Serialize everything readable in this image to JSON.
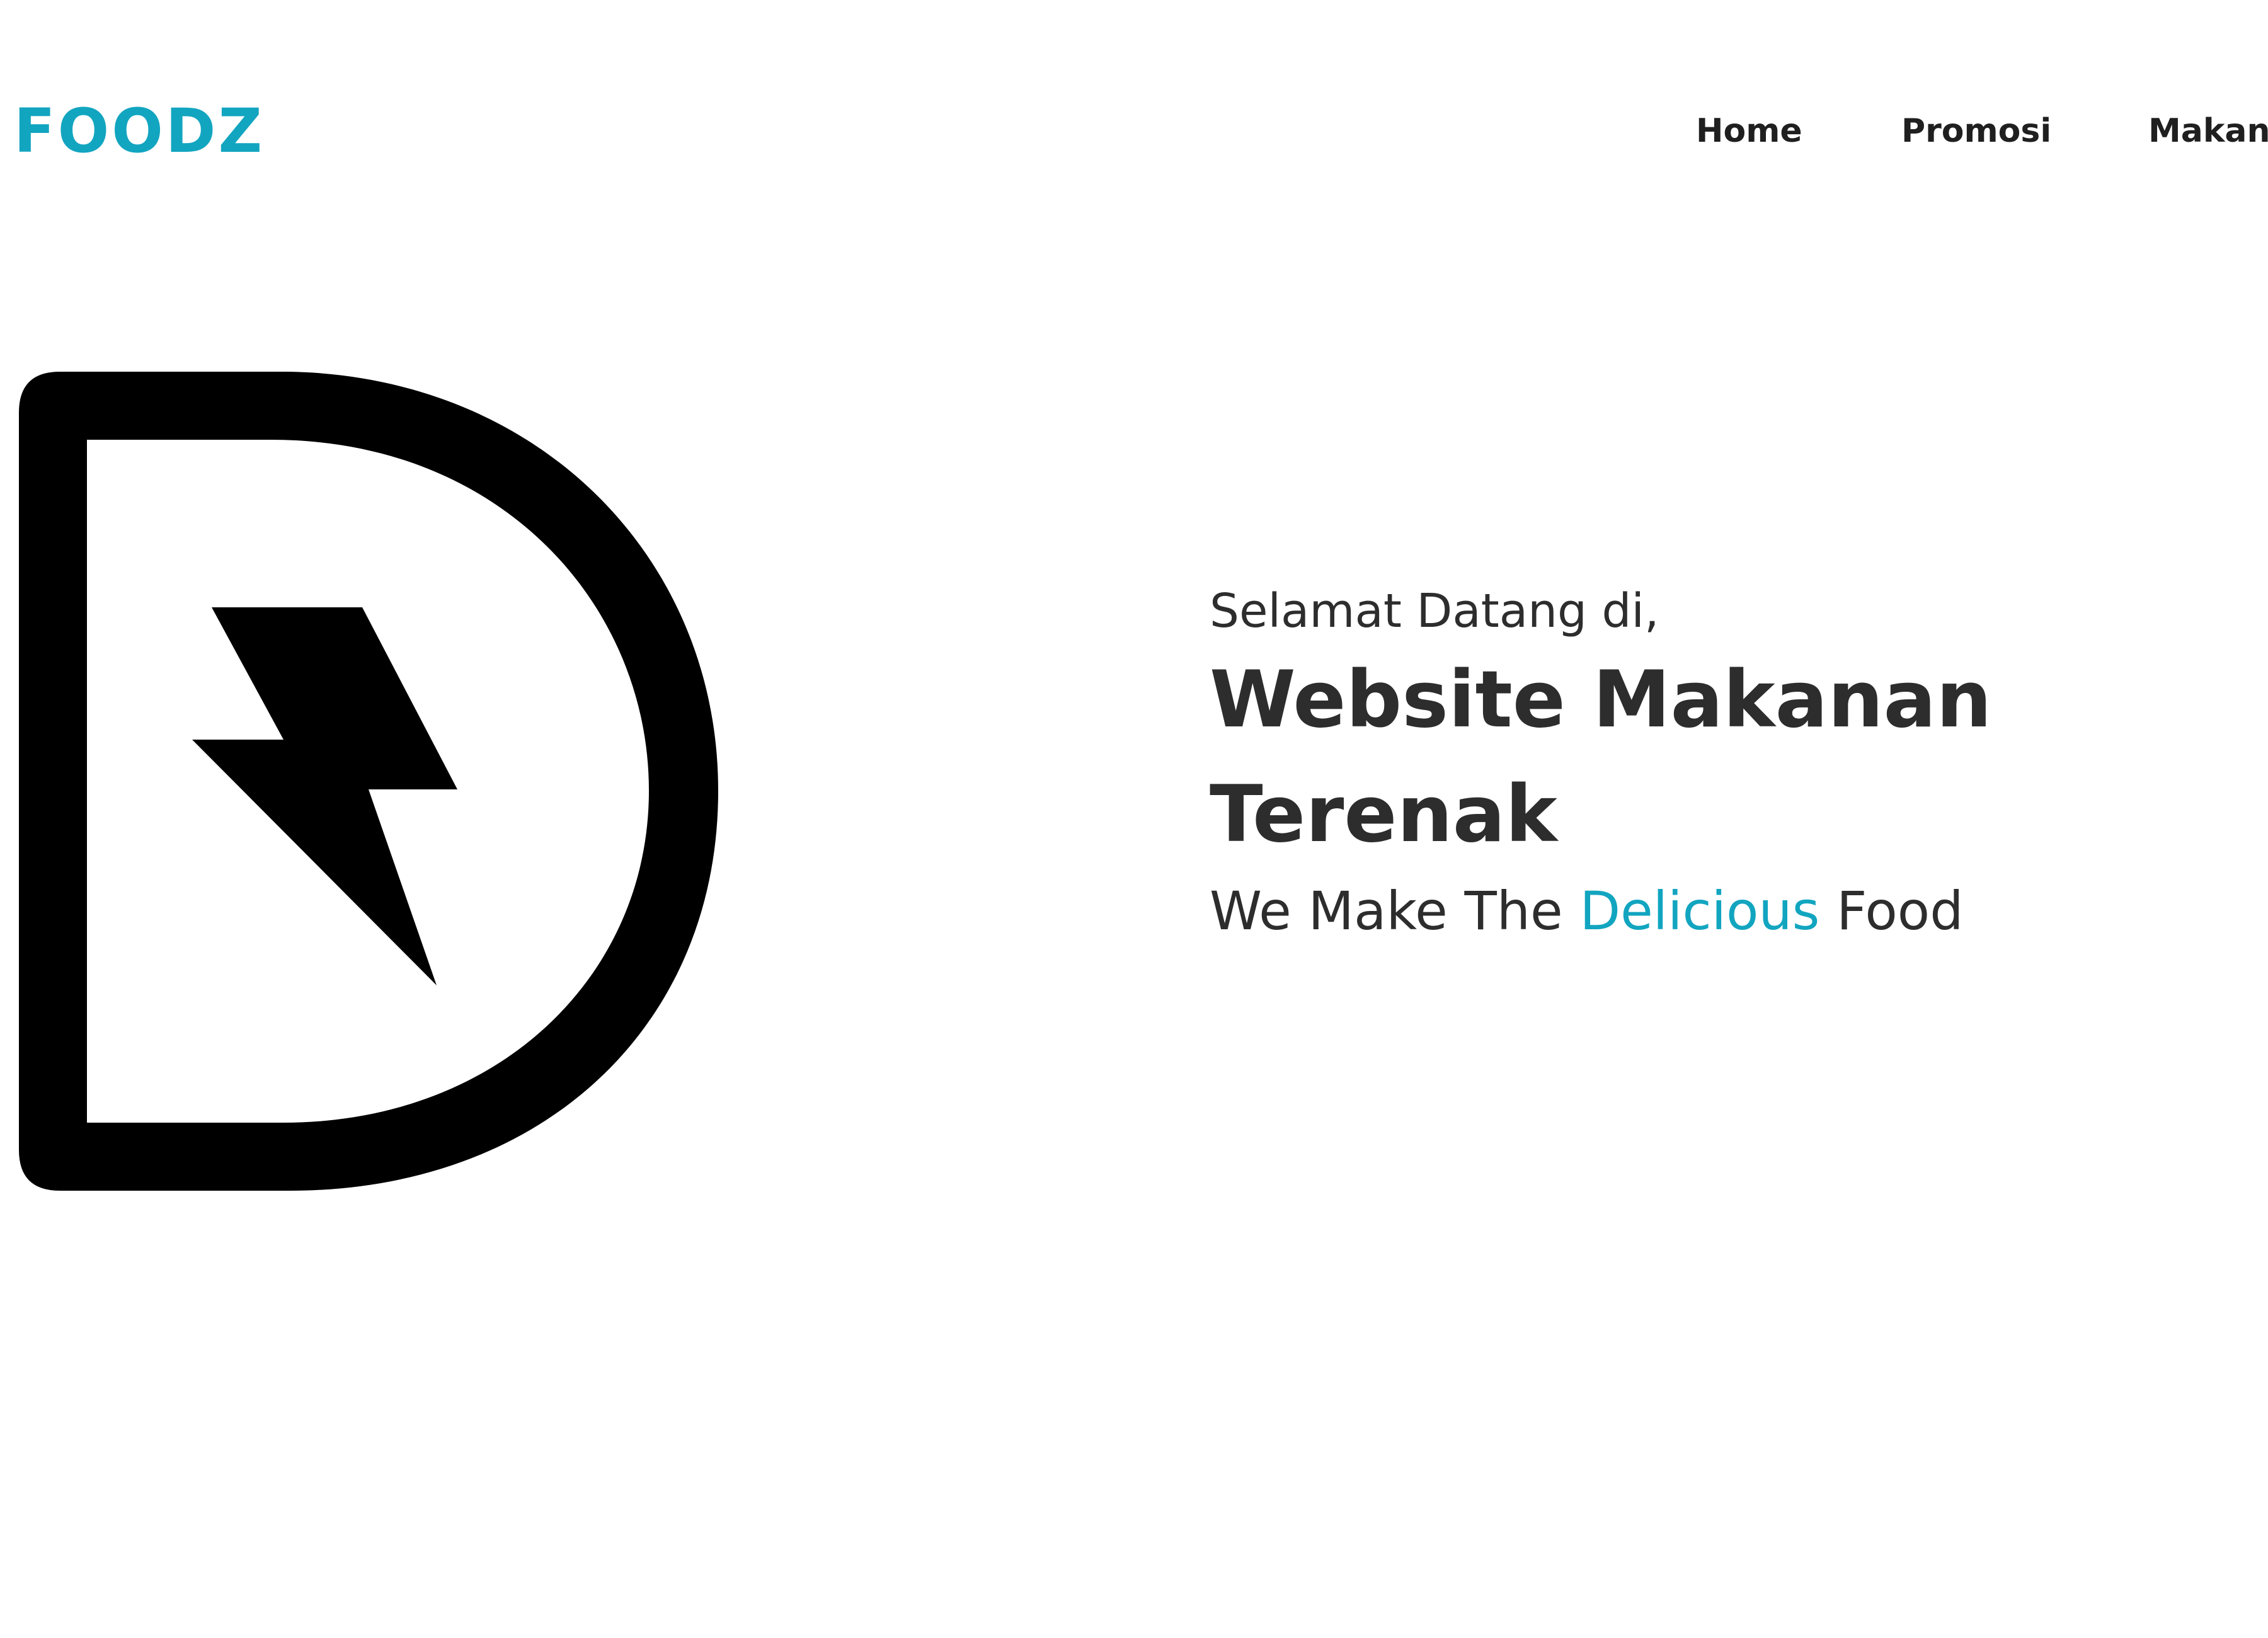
{
  "colors": {
    "accent": "#12a5c0",
    "text": "#2d2d2d",
    "background": "#ffffff"
  },
  "header": {
    "logo_text": "FOODZ",
    "nav": [
      {
        "label": "Home"
      },
      {
        "label": "Promosi"
      },
      {
        "label": "Makanan"
      }
    ]
  },
  "hero": {
    "image_icon": "d-lightning-logo-icon",
    "greeting": "Selamat Datang di,",
    "headline": "Website Makanan Terenak",
    "tagline_before": "We Make The ",
    "tagline_highlight": "Delicious",
    "tagline_after": " Food"
  }
}
